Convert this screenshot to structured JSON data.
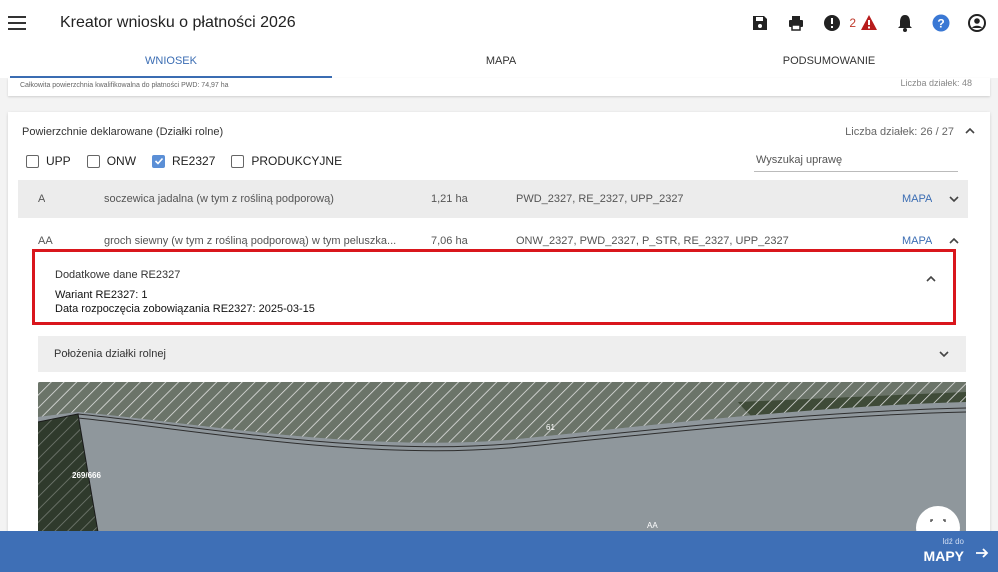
{
  "app": {
    "title": "Kreator wniosku o płatności 2026"
  },
  "header": {
    "warning_count": "2"
  },
  "tabs": [
    {
      "label": "WNIOSEK"
    },
    {
      "label": "MAPA"
    },
    {
      "label": "PODSUMOWANIE"
    }
  ],
  "summary": {
    "text": "Całkowita powierzchnia kwalifikowalna do płatności PWD: 74,97 ha",
    "right_text": "Liczba działek: 48"
  },
  "section": {
    "title": "Powierzchnie deklarowane (Działki rolne)",
    "count": "Liczba działek: 26 / 27",
    "filters": [
      {
        "label": "UPP",
        "checked": false
      },
      {
        "label": "ONW",
        "checked": false
      },
      {
        "label": "RE2327",
        "checked": true
      },
      {
        "label": "PRODUKCYJNE",
        "checked": false
      }
    ],
    "search_placeholder": "Wyszukaj uprawę"
  },
  "rows": [
    {
      "code": "A",
      "crop": "soczewica jadalna (w tym z rośliną podporową)",
      "area": "1,21 ha",
      "programs": "PWD_2327, RE_2327, UPP_2327",
      "map_label": "MAPA"
    },
    {
      "code": "AA",
      "crop": "groch siewny (w tym z rośliną podporową) w tym peluszka...",
      "area": "7,06 ha",
      "programs": "ONW_2327, PWD_2327, P_STR, RE_2327, UPP_2327",
      "map_label": "MAPA"
    }
  ],
  "details": {
    "title": "Dodatkowe dane RE2327",
    "line1": "Wariant RE2327: 1",
    "line2": "Data rozpoczęcia zobowiązania RE2327: 2025-03-15"
  },
  "positions": {
    "label": "Położenia działki rolnej"
  },
  "map": {
    "labels": [
      "61",
      "269/666",
      "AA"
    ]
  },
  "footer": {
    "go_to": "Idź do",
    "button": "MAPY"
  },
  "colors": {
    "accent": "#3b6db3",
    "highlight_border": "#d9161c",
    "warning": "#c0392b",
    "help": "#3a78d4"
  },
  "icons": [
    "menu-icon",
    "save-icon",
    "print-icon",
    "alert-circle-icon",
    "warning-triangle-icon",
    "bell-icon",
    "help-icon",
    "account-icon",
    "chevron-up-icon",
    "chevron-down-icon",
    "fullscreen-icon",
    "arrow-right-icon"
  ]
}
